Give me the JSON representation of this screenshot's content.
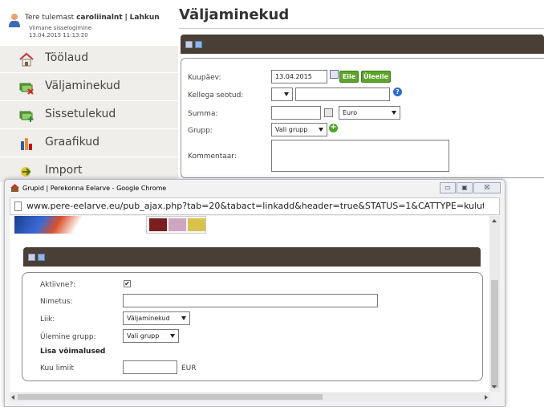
{
  "header": {
    "greeting": "Tere tulemast",
    "username": "caroliinalnt",
    "separator": "|",
    "logout": "Lahkun",
    "last_login_label": "Viimane sisselogimine",
    "last_login_time": "13.04.2015 11:13:20"
  },
  "sidebar": {
    "items": [
      {
        "label": "Töölaud",
        "icon": "home-icon"
      },
      {
        "label": "Väljaminekud",
        "icon": "money-minus-icon"
      },
      {
        "label": "Sissetulekud",
        "icon": "money-plus-icon"
      },
      {
        "label": "Graafikud",
        "icon": "bar-chart-icon"
      },
      {
        "label": "Import",
        "icon": "import-arrow-icon"
      }
    ]
  },
  "main": {
    "title": "Väljaminekud",
    "form": {
      "date_label": "Kuupäev:",
      "date_value": "13.04.2015",
      "yesterday_button": "Eile",
      "day_before_button": "Üleeile",
      "related_label": "Kellega seotud:",
      "related_value": "",
      "amount_label": "Summa:",
      "amount_value": "",
      "currency_value": "Euro",
      "group_label": "Grupp:",
      "group_value": "Vali grupp",
      "comment_label": "Kommentaar:",
      "comment_value": ""
    }
  },
  "popup": {
    "window_title": "Grupid | Perekonna Eelarve - Google Chrome",
    "url": "www.pere-eelarve.eu/pub_ajax.php?tab=20&tabact=linkadd&header=true&STATUS=1&CATTYPE=kulutused&re",
    "window_buttons": {
      "minimize": "▭",
      "maximize": "▣",
      "close": "☒"
    },
    "form": {
      "active_label": "Aktiivne?:",
      "active_checked": true,
      "name_label": "Nimetus:",
      "name_value": "",
      "type_label": "Liik:",
      "type_value": "Väljaminekud",
      "parent_label": "Ülemine grupp:",
      "parent_value": "Vali grupp",
      "options_heading": "Lisa võimalused",
      "monthly_limit_label": "Kuu limiit",
      "monthly_limit_value": "",
      "currency_suffix": "EUR"
    }
  },
  "colors": {
    "toolbar": "#4a3f37",
    "sidebar_bg": "#efeeea",
    "green_button": "#5da42b",
    "help_blue": "#2a6bd0"
  }
}
